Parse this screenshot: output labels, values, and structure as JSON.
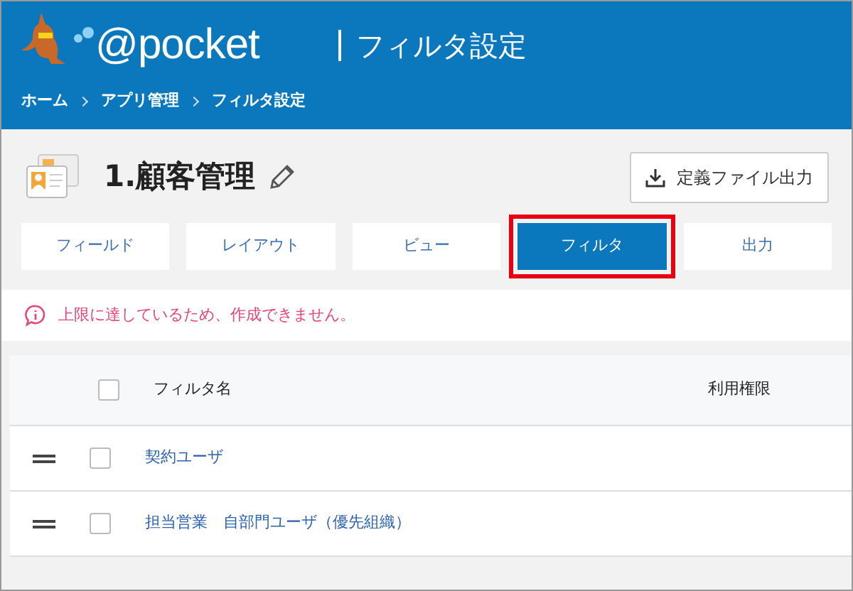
{
  "header": {
    "logo_text": "@pocket",
    "page_title": "フィルタ設定",
    "breadcrumbs": [
      "ホーム",
      "アプリ管理",
      "フィルタ設定"
    ]
  },
  "app": {
    "title": "1.顧客管理",
    "export_button": "定義ファイル出力"
  },
  "tabs": [
    {
      "label": "フィールド",
      "selected": false,
      "highlighted": false
    },
    {
      "label": "レイアウト",
      "selected": false,
      "highlighted": false
    },
    {
      "label": "ビュー",
      "selected": false,
      "highlighted": false
    },
    {
      "label": "フィルタ",
      "selected": true,
      "highlighted": true
    },
    {
      "label": "出力",
      "selected": false,
      "highlighted": false
    }
  ],
  "alert": "上限に達しているため、作成できません。",
  "table": {
    "header_checked": false,
    "columns": [
      "フィルタ名",
      "利用権限"
    ],
    "rows": [
      {
        "name": "契約ユーザ",
        "checked": false
      },
      {
        "name": "担当営業　自部門ユーザ（優先組織）",
        "checked": false
      }
    ]
  }
}
